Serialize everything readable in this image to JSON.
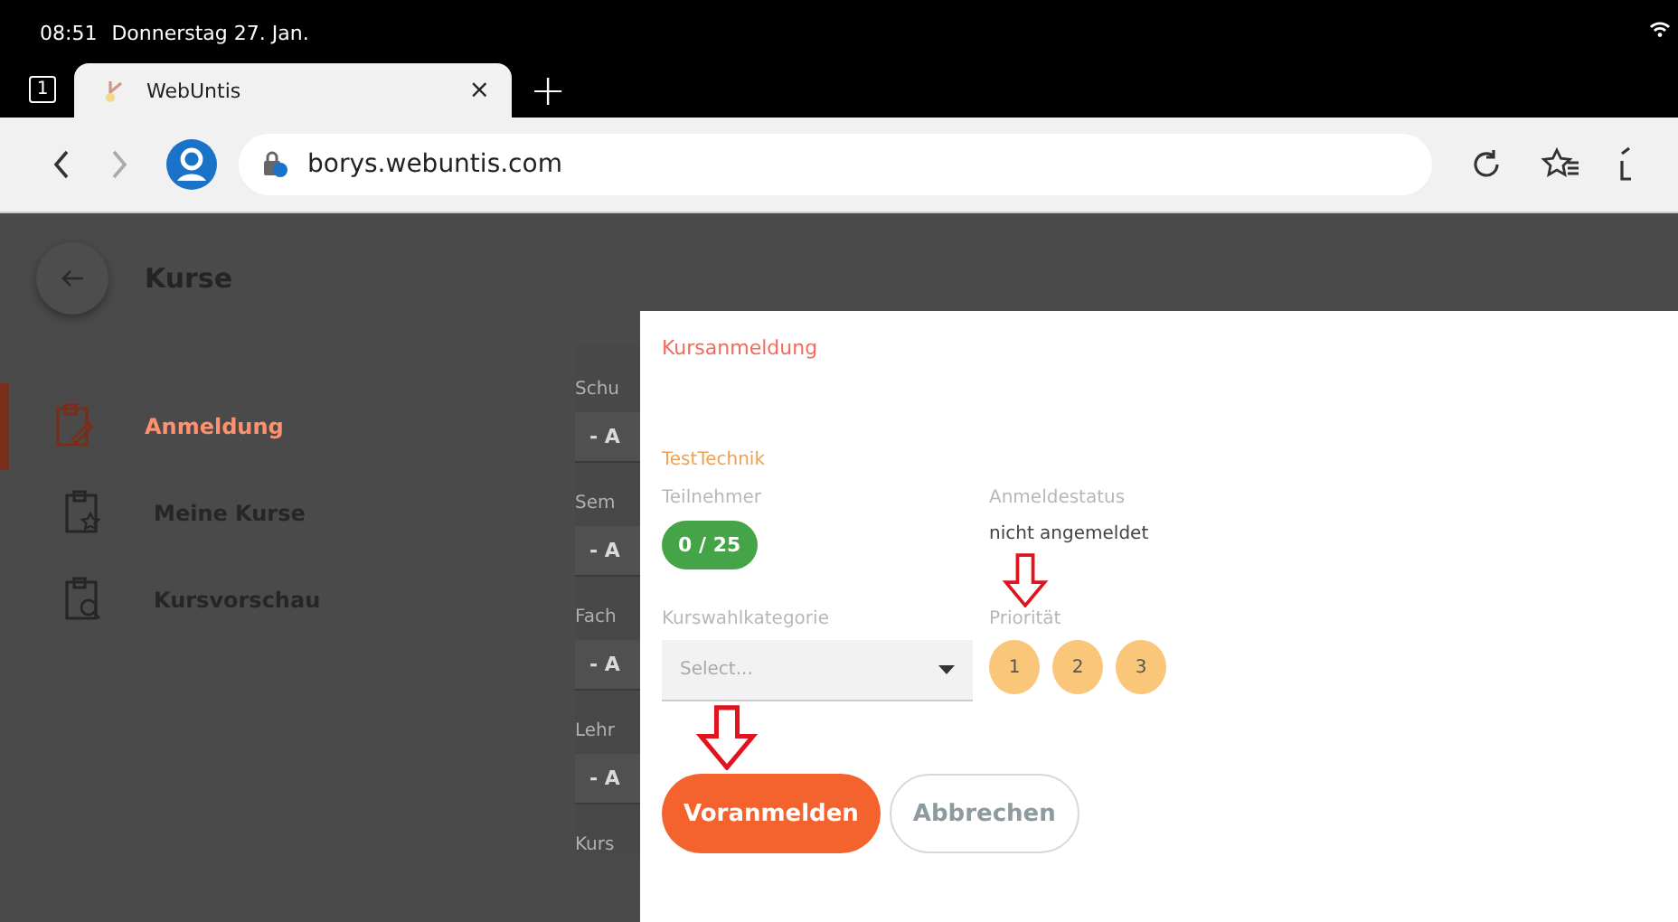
{
  "status_bar": {
    "time": "08:51",
    "date": "Donnerstag 27. Jan."
  },
  "browser": {
    "tab_count": "1",
    "tabs": [
      {
        "title": "WebUntis",
        "close": "×",
        "selected": true
      }
    ],
    "new_tab": "+",
    "url": "borys.webuntis.com"
  },
  "page": {
    "title": "Kurse",
    "nav": [
      {
        "label": "Anmeldung",
        "selected": true
      },
      {
        "label": "Meine Kurse",
        "selected": false
      },
      {
        "label": "Kursvorschau",
        "selected": false
      }
    ],
    "filters": [
      {
        "label": "Schu",
        "value": "- A"
      },
      {
        "label": "Sem",
        "value": "- A"
      },
      {
        "label": "Fach",
        "value": "- A"
      },
      {
        "label": "Lehr",
        "value": "- A"
      },
      {
        "label": "Kurs"
      }
    ]
  },
  "dialog": {
    "title": "Kursanmeldung",
    "course": "TestTechnik",
    "participants": {
      "label": "Teilnehmer",
      "value": "0 / 25"
    },
    "status": {
      "label": "Anmeldestatus",
      "value": "nicht angemeldet"
    },
    "category": {
      "label": "Kurswahlkategorie",
      "placeholder": "Select..."
    },
    "priority": {
      "label": "Priorität",
      "options": [
        {
          "label": "1",
          "selected": false
        },
        {
          "label": "2",
          "selected": false
        },
        {
          "label": "3",
          "selected": false
        }
      ]
    },
    "buttons": [
      {
        "label": "Voranmelden",
        "kind": "primary"
      },
      {
        "label": "Abbrechen",
        "kind": "secondary"
      }
    ]
  }
}
